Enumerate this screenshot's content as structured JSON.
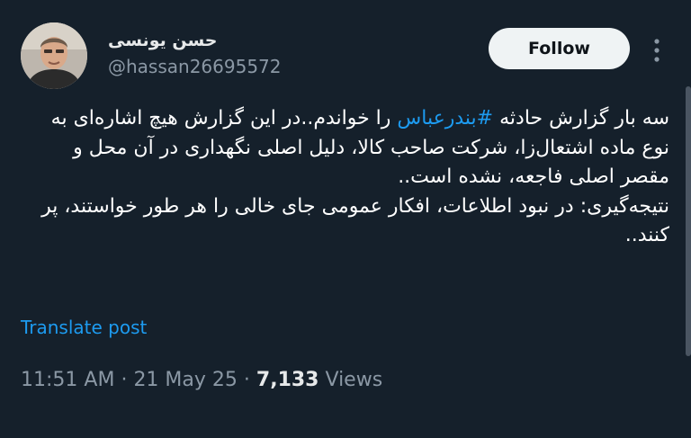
{
  "author": {
    "display_name": "حسن یونسی",
    "handle": "@hassan26695572",
    "avatar_icon": "profile-photo"
  },
  "follow_label": "Follow",
  "tweet": {
    "line1_before": "سه بار گزارش حادثه ",
    "hashtag": "#بندرعباس",
    "line1_after": " را خواندم..در این گزارش هیچ اشاره‌ای به نوع ماده اشتعال‌زا، شرکت صاحب کالا، دلیل اصلی نگهداری در آن محل و مقصر اصلی فاجعه، نشده است..",
    "paragraph2": "نتیجه‌گیری: در نبود اطلاعات، افکار عمومی جای خالی را هر طور خواستند، پر کنند.."
  },
  "translate_label": "Translate post",
  "meta": {
    "time": "11:51 AM",
    "separator": "·",
    "date": "21 May 25",
    "views_count": "7,133",
    "views_label": "Views"
  },
  "colors": {
    "background": "#15202b",
    "link": "#1d9bf0",
    "secondary_text": "#8b98a5"
  }
}
